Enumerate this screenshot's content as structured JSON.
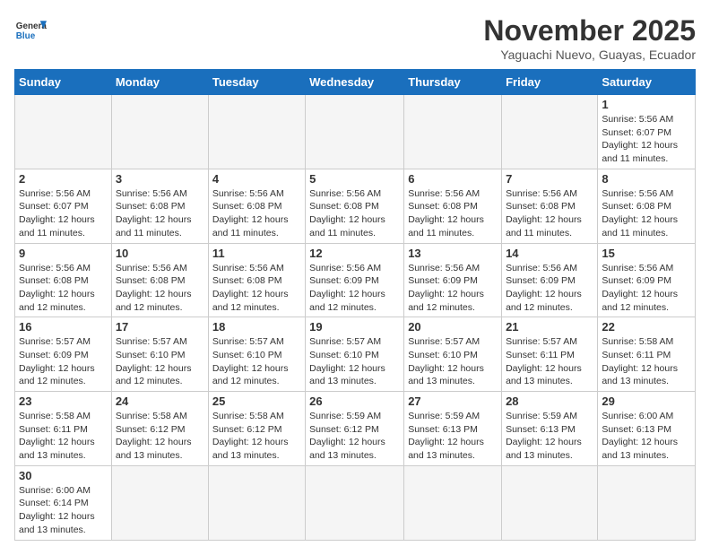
{
  "header": {
    "logo_general": "General",
    "logo_blue": "Blue",
    "month_title": "November 2025",
    "subtitle": "Yaguachi Nuevo, Guayas, Ecuador"
  },
  "weekdays": [
    "Sunday",
    "Monday",
    "Tuesday",
    "Wednesday",
    "Thursday",
    "Friday",
    "Saturday"
  ],
  "weeks": [
    [
      {
        "day": "",
        "info": ""
      },
      {
        "day": "",
        "info": ""
      },
      {
        "day": "",
        "info": ""
      },
      {
        "day": "",
        "info": ""
      },
      {
        "day": "",
        "info": ""
      },
      {
        "day": "",
        "info": ""
      },
      {
        "day": "1",
        "info": "Sunrise: 5:56 AM\nSunset: 6:07 PM\nDaylight: 12 hours\nand 11 minutes."
      }
    ],
    [
      {
        "day": "2",
        "info": "Sunrise: 5:56 AM\nSunset: 6:07 PM\nDaylight: 12 hours\nand 11 minutes."
      },
      {
        "day": "3",
        "info": "Sunrise: 5:56 AM\nSunset: 6:08 PM\nDaylight: 12 hours\nand 11 minutes."
      },
      {
        "day": "4",
        "info": "Sunrise: 5:56 AM\nSunset: 6:08 PM\nDaylight: 12 hours\nand 11 minutes."
      },
      {
        "day": "5",
        "info": "Sunrise: 5:56 AM\nSunset: 6:08 PM\nDaylight: 12 hours\nand 11 minutes."
      },
      {
        "day": "6",
        "info": "Sunrise: 5:56 AM\nSunset: 6:08 PM\nDaylight: 12 hours\nand 11 minutes."
      },
      {
        "day": "7",
        "info": "Sunrise: 5:56 AM\nSunset: 6:08 PM\nDaylight: 12 hours\nand 11 minutes."
      },
      {
        "day": "8",
        "info": "Sunrise: 5:56 AM\nSunset: 6:08 PM\nDaylight: 12 hours\nand 11 minutes."
      }
    ],
    [
      {
        "day": "9",
        "info": "Sunrise: 5:56 AM\nSunset: 6:08 PM\nDaylight: 12 hours\nand 12 minutes."
      },
      {
        "day": "10",
        "info": "Sunrise: 5:56 AM\nSunset: 6:08 PM\nDaylight: 12 hours\nand 12 minutes."
      },
      {
        "day": "11",
        "info": "Sunrise: 5:56 AM\nSunset: 6:08 PM\nDaylight: 12 hours\nand 12 minutes."
      },
      {
        "day": "12",
        "info": "Sunrise: 5:56 AM\nSunset: 6:09 PM\nDaylight: 12 hours\nand 12 minutes."
      },
      {
        "day": "13",
        "info": "Sunrise: 5:56 AM\nSunset: 6:09 PM\nDaylight: 12 hours\nand 12 minutes."
      },
      {
        "day": "14",
        "info": "Sunrise: 5:56 AM\nSunset: 6:09 PM\nDaylight: 12 hours\nand 12 minutes."
      },
      {
        "day": "15",
        "info": "Sunrise: 5:56 AM\nSunset: 6:09 PM\nDaylight: 12 hours\nand 12 minutes."
      }
    ],
    [
      {
        "day": "16",
        "info": "Sunrise: 5:57 AM\nSunset: 6:09 PM\nDaylight: 12 hours\nand 12 minutes."
      },
      {
        "day": "17",
        "info": "Sunrise: 5:57 AM\nSunset: 6:10 PM\nDaylight: 12 hours\nand 12 minutes."
      },
      {
        "day": "18",
        "info": "Sunrise: 5:57 AM\nSunset: 6:10 PM\nDaylight: 12 hours\nand 12 minutes."
      },
      {
        "day": "19",
        "info": "Sunrise: 5:57 AM\nSunset: 6:10 PM\nDaylight: 12 hours\nand 13 minutes."
      },
      {
        "day": "20",
        "info": "Sunrise: 5:57 AM\nSunset: 6:10 PM\nDaylight: 12 hours\nand 13 minutes."
      },
      {
        "day": "21",
        "info": "Sunrise: 5:57 AM\nSunset: 6:11 PM\nDaylight: 12 hours\nand 13 minutes."
      },
      {
        "day": "22",
        "info": "Sunrise: 5:58 AM\nSunset: 6:11 PM\nDaylight: 12 hours\nand 13 minutes."
      }
    ],
    [
      {
        "day": "23",
        "info": "Sunrise: 5:58 AM\nSunset: 6:11 PM\nDaylight: 12 hours\nand 13 minutes."
      },
      {
        "day": "24",
        "info": "Sunrise: 5:58 AM\nSunset: 6:12 PM\nDaylight: 12 hours\nand 13 minutes."
      },
      {
        "day": "25",
        "info": "Sunrise: 5:58 AM\nSunset: 6:12 PM\nDaylight: 12 hours\nand 13 minutes."
      },
      {
        "day": "26",
        "info": "Sunrise: 5:59 AM\nSunset: 6:12 PM\nDaylight: 12 hours\nand 13 minutes."
      },
      {
        "day": "27",
        "info": "Sunrise: 5:59 AM\nSunset: 6:13 PM\nDaylight: 12 hours\nand 13 minutes."
      },
      {
        "day": "28",
        "info": "Sunrise: 5:59 AM\nSunset: 6:13 PM\nDaylight: 12 hours\nand 13 minutes."
      },
      {
        "day": "29",
        "info": "Sunrise: 6:00 AM\nSunset: 6:13 PM\nDaylight: 12 hours\nand 13 minutes."
      }
    ],
    [
      {
        "day": "30",
        "info": "Sunrise: 6:00 AM\nSunset: 6:14 PM\nDaylight: 12 hours\nand 13 minutes."
      },
      {
        "day": "",
        "info": ""
      },
      {
        "day": "",
        "info": ""
      },
      {
        "day": "",
        "info": ""
      },
      {
        "day": "",
        "info": ""
      },
      {
        "day": "",
        "info": ""
      },
      {
        "day": "",
        "info": ""
      }
    ]
  ]
}
